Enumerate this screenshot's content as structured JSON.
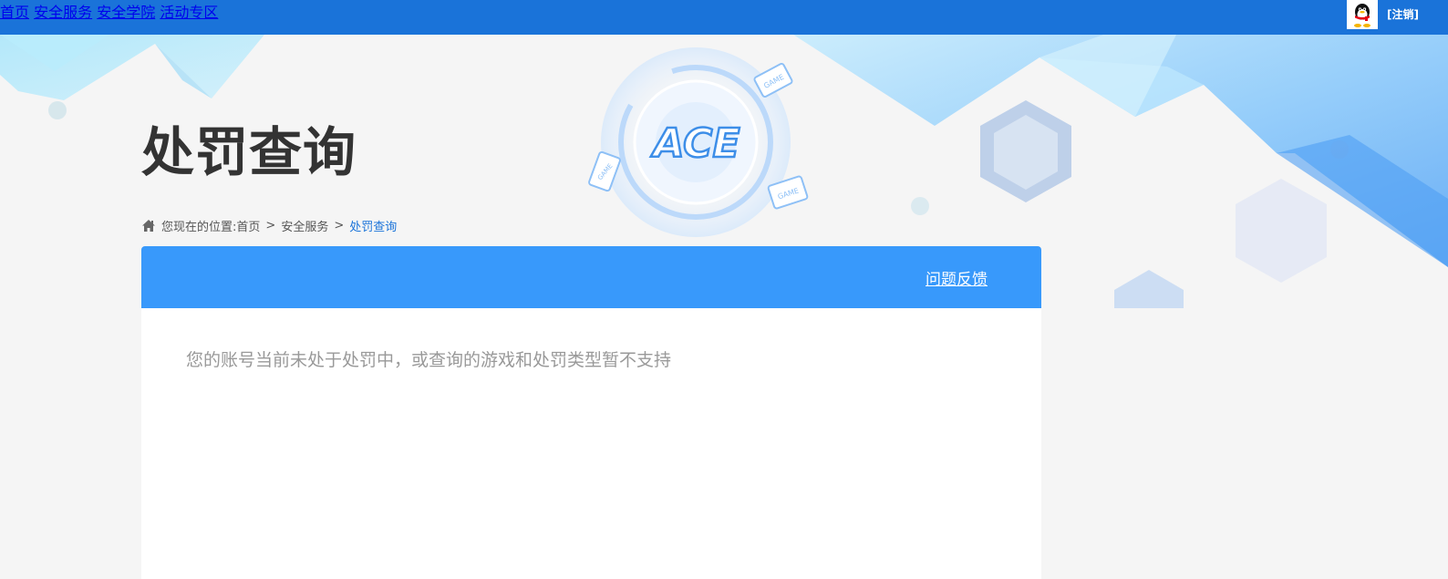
{
  "nav": {
    "items": [
      "首页",
      "安全服务",
      "安全学院",
      "活动专区"
    ],
    "logout": "[注销]"
  },
  "page": {
    "title": "处罚查询"
  },
  "breadcrumb": {
    "prefix": "您现在的位置:",
    "items": [
      "首页",
      "安全服务",
      "处罚查询"
    ],
    "separator": ">"
  },
  "banner": {
    "logo_text": "ACE",
    "device_labels": [
      "GAME",
      "GAME",
      "GAME"
    ]
  },
  "panel": {
    "feedback_label": "问题反馈",
    "message": "您的账号当前未处于处罚中，或查询的游戏和处罚类型暂不支持"
  },
  "colors": {
    "topbar": "#1a73d9",
    "panel_header": "#3899fb",
    "title": "#333333",
    "message": "#999999",
    "breadcrumb_current": "#1a73d9"
  },
  "icons": [
    "home-icon",
    "qq-avatar-icon",
    "ace-logo-icon"
  ]
}
